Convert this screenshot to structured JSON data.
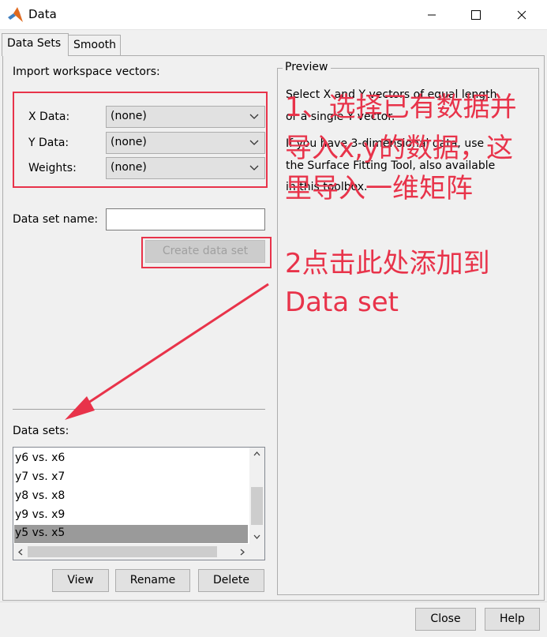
{
  "window": {
    "title": "Data"
  },
  "tabs": [
    "Data Sets",
    "Smooth"
  ],
  "import": {
    "heading": "Import workspace vectors:",
    "x_label": "X Data:",
    "x_value": "(none)",
    "y_label": "Y Data:",
    "y_value": "(none)",
    "w_label": "Weights:",
    "w_value": "(none)",
    "name_label": "Data set name:",
    "name_value": "",
    "create_button": "Create data set"
  },
  "datasets": {
    "label": "Data sets:",
    "items": [
      "y6 vs. x6",
      "y7 vs. x7",
      "y8 vs. x8",
      "y9 vs. x9",
      "y5 vs. x5"
    ],
    "selected": "y5 vs. x5",
    "view_button": "View",
    "rename_button": "Rename",
    "delete_button": "Delete"
  },
  "preview": {
    "title": "Preview",
    "lines": [
      "Select X and Y vectors of equal length",
      "or a single Y vector.",
      "If you have 3-dimensional data, use",
      "the Surface Fitting Tool, also available",
      "in this toolbox."
    ]
  },
  "annotations": {
    "step1": [
      "1、选择已有数据并",
      "导入x,y的数据，这",
      "里导入一维矩阵"
    ],
    "step2": [
      "2点击此处添加到",
      "Data set"
    ],
    "color": "#e8334a"
  },
  "footer": {
    "close_button": "Close",
    "help_button": "Help"
  }
}
